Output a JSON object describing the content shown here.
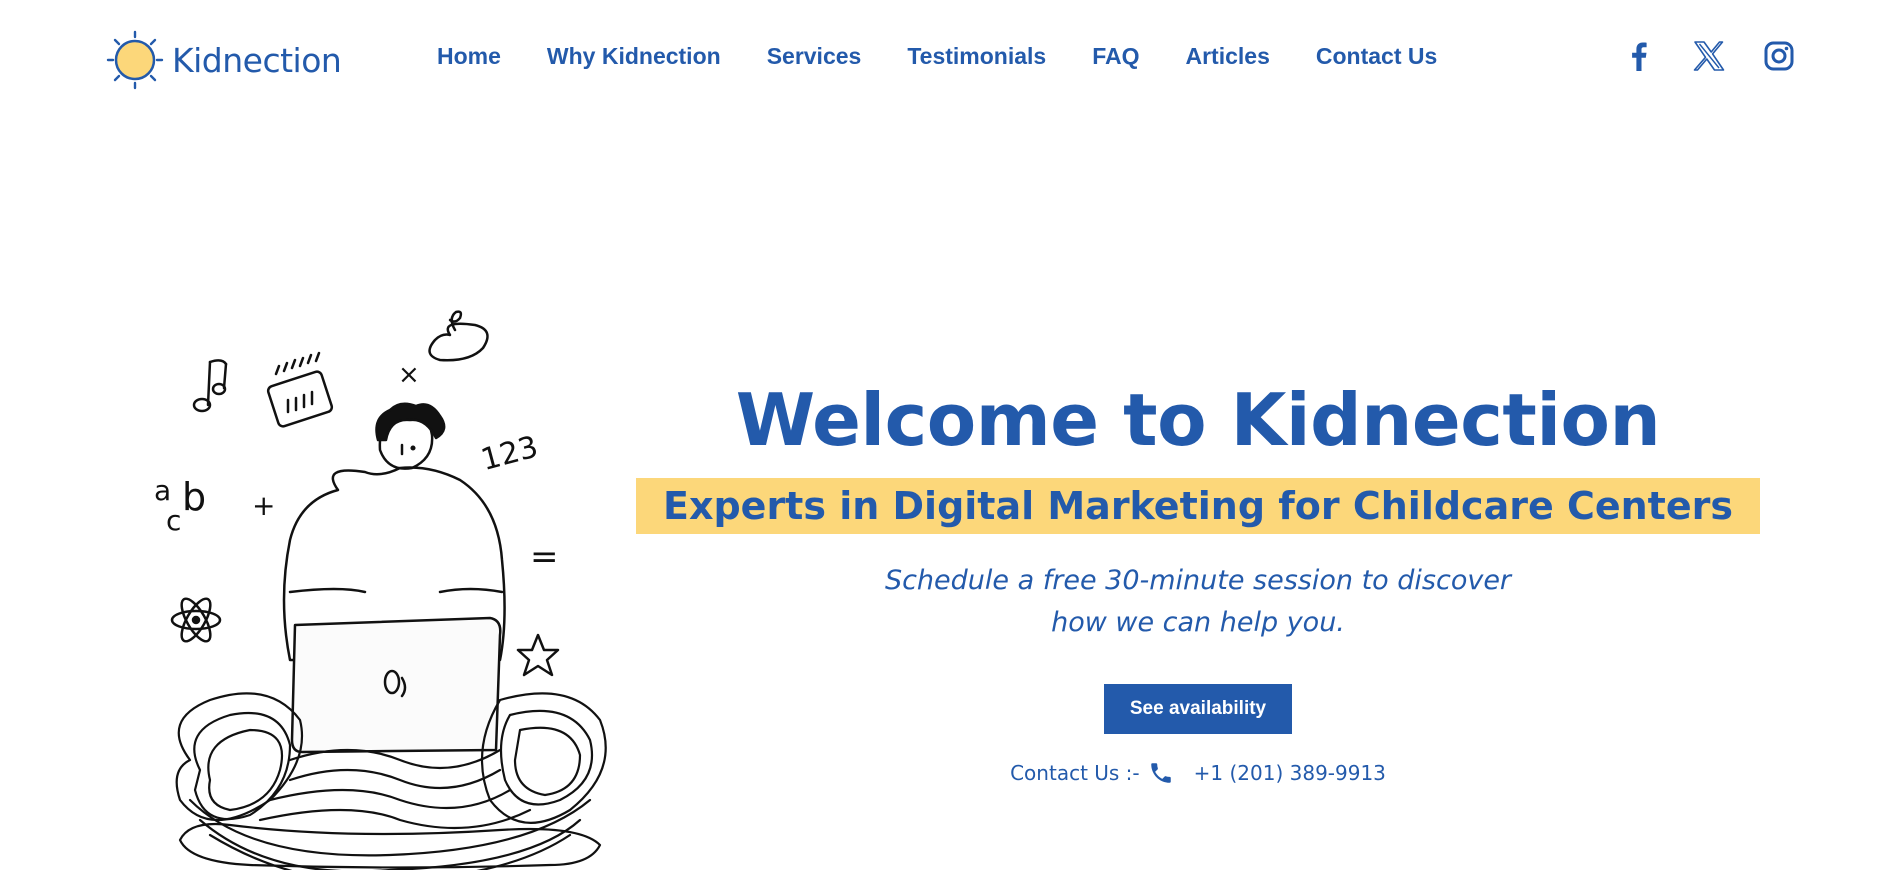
{
  "brand": {
    "name": "Kidnection"
  },
  "nav": {
    "items": [
      "Home",
      "Why Kidnection",
      "Services",
      "Testimonials",
      "FAQ",
      "Articles",
      "Contact Us"
    ]
  },
  "social": {
    "icons": [
      "facebook-icon",
      "x-icon",
      "instagram-icon"
    ]
  },
  "hero": {
    "title": "Welcome to Kidnection",
    "subtitle": "Experts in Digital Marketing for Childcare Centers",
    "description_line1": "Schedule a free 30-minute session to discover",
    "description_line2": "how we can help you.",
    "cta_label": "See availability",
    "contact_label": "Contact Us :-",
    "phone": "+1 (201) 389-9913"
  },
  "illustration": {
    "doodle_text": [
      "a",
      "b",
      "c",
      "+",
      "×",
      "123",
      "="
    ]
  },
  "colors": {
    "brand_blue": "#235aab",
    "highlight_yellow": "#fcd77a",
    "sun_yellow": "#fcd77a",
    "background": "#ffffff"
  }
}
